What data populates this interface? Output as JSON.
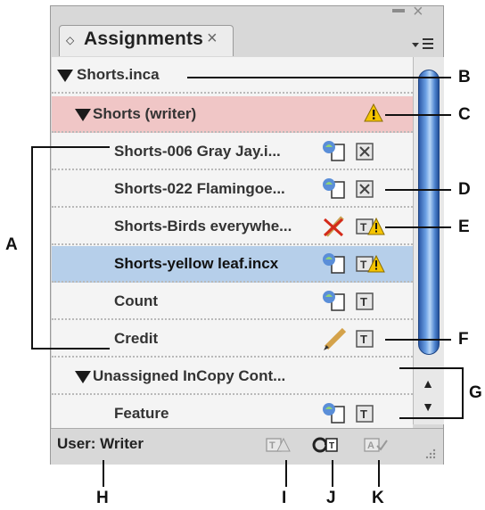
{
  "panel": {
    "tab_arrows": "◇",
    "tab_title": "Assignments",
    "tab_close": "×",
    "window_close": "×",
    "menu_icon": "▾☰"
  },
  "rows": [
    {
      "label": "Shorts.inca",
      "style": "header"
    },
    {
      "label": "Shorts (writer)",
      "style": "assignment"
    },
    {
      "label": "Shorts-006 Gray Jay.i...",
      "style": "item"
    },
    {
      "label": "Shorts-022 Flamingoe...",
      "style": "item"
    },
    {
      "label": "Shorts-Birds everywhe...",
      "style": "item"
    },
    {
      "label": "Shorts-yellow leaf.incx",
      "style": "selected"
    },
    {
      "label": "Count",
      "style": "item"
    },
    {
      "label": "Credit",
      "style": "item"
    },
    {
      "label": "Unassigned InCopy Cont...",
      "style": "header2"
    },
    {
      "label": "Feature",
      "style": "item"
    }
  ],
  "footer": {
    "user_label": "User: Writer"
  },
  "scrollbar": {
    "up_arrow": "▲",
    "down_arrow": "▼"
  },
  "callouts": {
    "A": "A",
    "B": "B",
    "C": "C",
    "D": "D",
    "E": "E",
    "F": "F",
    "G": "G",
    "H": "H",
    "I": "I",
    "J": "J",
    "K": "K"
  },
  "colors": {
    "assignment_row": "#f0c6c6",
    "selected_row": "#b6cfea",
    "scroll_thumb": "#4f85d0"
  }
}
